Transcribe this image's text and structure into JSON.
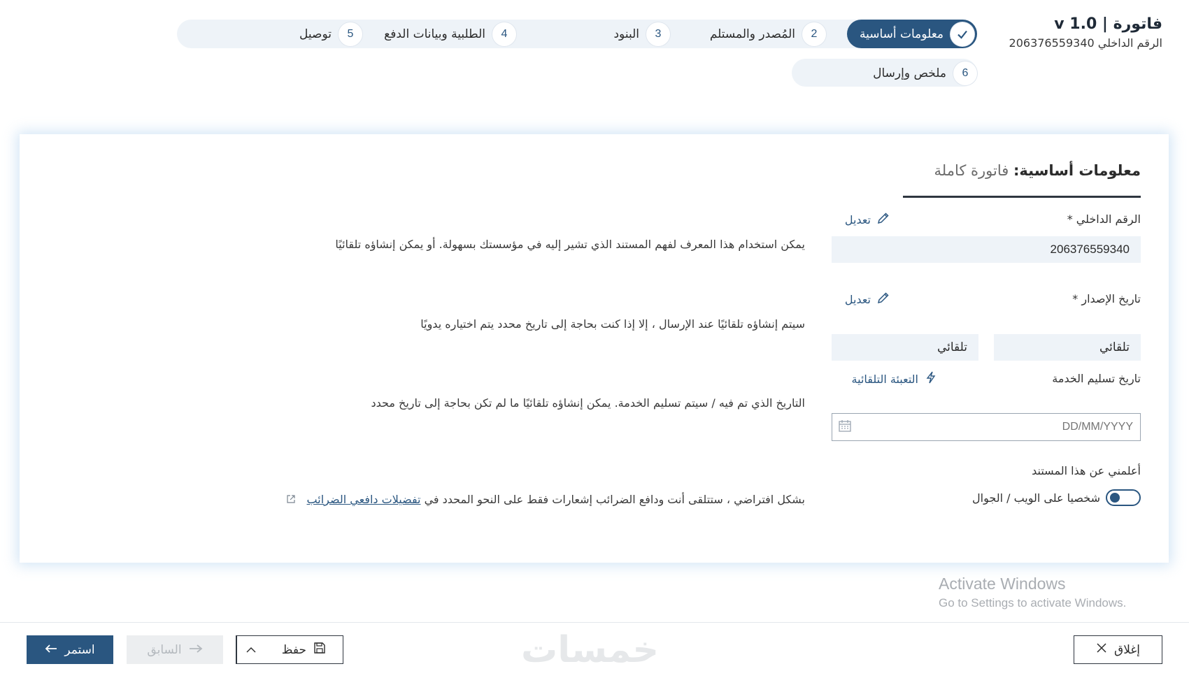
{
  "header": {
    "title": "فاتورة | v 1.0",
    "subtitle": "الرقم الداخلي 206376559340"
  },
  "stepper": {
    "steps": [
      {
        "num": "1",
        "label": "معلومات أساسية",
        "state": "done"
      },
      {
        "num": "2",
        "label": "المُصدر والمستلم"
      },
      {
        "num": "3",
        "label": "البنود"
      },
      {
        "num": "4",
        "label": "الطلبية وبيانات الدفع"
      },
      {
        "num": "5",
        "label": "توصيل"
      },
      {
        "num": "6",
        "label": "ملخص وإرسال"
      }
    ]
  },
  "card": {
    "heading_strong": "معلومات أساسية:",
    "heading_light": "فاتورة كاملة",
    "fields": {
      "internal_number": {
        "label": "الرقم الداخلي *",
        "action": "تعديل",
        "value": "206376559340",
        "help": "يمكن استخدام هذا المعرف لفهم المستند الذي تشير إليه في مؤسستك بسهولة. أو يمكن إنشاؤه تلقائيًا"
      },
      "issue_date": {
        "label": "تاريخ الإصدار *",
        "action": "تعديل",
        "value_date": "تلقائي",
        "value_time": "تلقائي",
        "help": "سيتم إنشاؤه تلقائيًا عند الإرسال ، إلا إذا كنت بحاجة إلى تاريخ محدد يتم اختياره يدويًا"
      },
      "service_date": {
        "label": "تاريخ تسليم الخدمة",
        "action": "التعبئة التلقائية",
        "placeholder": "DD/MM/YYYY",
        "help": "التاريخ الذي تم فيه / سيتم تسليم الخدمة. يمكن إنشاؤه تلقائيًا ما لم تكن بحاجة إلى تاريخ محدد"
      },
      "notify": {
        "label": "أعلمني عن هذا المستند",
        "toggle_label": "شخصيا على الويب / الجوال",
        "toggle_on": true,
        "help_prefix": "بشكل افتراضي ، ستتلقى أنت ودافع الضرائب إشعارات فقط على النحو المحدد في",
        "help_link": "تفضيلات دافعي الضرائب"
      }
    }
  },
  "watermark": {
    "line1": "Activate Windows",
    "line2": "Go to Settings to activate Windows.",
    "brand": "خمسات"
  },
  "footer": {
    "continue": "استمر",
    "previous": "السابق",
    "save": "حفظ",
    "close": "إغلاق"
  },
  "colors": {
    "primary": "#2a5680",
    "field_bg": "#eef3f8",
    "disabled_bg": "#eceef0"
  }
}
